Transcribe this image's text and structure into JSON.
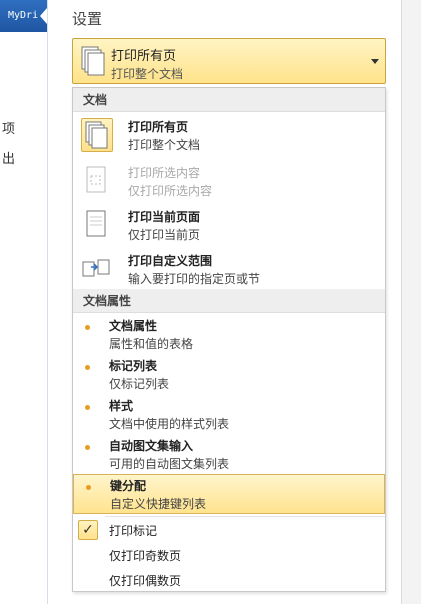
{
  "left_panel": {
    "tab_label": "MyDri",
    "items": [
      "项",
      "出"
    ]
  },
  "settings": {
    "heading": "设置",
    "selector": {
      "title": "打印所有页",
      "subtitle": "打印整个文档",
      "icon": "pages-icon"
    }
  },
  "dropdown": {
    "document_section": {
      "header": "文档",
      "items": [
        {
          "title": "打印所有页",
          "desc": "打印整个文档",
          "icon": "all-pages-icon",
          "highlighted": true,
          "disabled": false
        },
        {
          "title": "打印所选内容",
          "desc": "仅打印所选内容",
          "icon": "selection-icon",
          "highlighted": false,
          "disabled": true
        },
        {
          "title": "打印当前页面",
          "desc": "仅打印当前页",
          "icon": "current-page-icon",
          "highlighted": false,
          "disabled": false
        },
        {
          "title": "打印自定义范围",
          "desc": "输入要打印的指定页或节",
          "icon": "custom-range-icon",
          "highlighted": false,
          "disabled": false
        }
      ]
    },
    "properties_section": {
      "header": "文档属性",
      "items": [
        {
          "title": "文档属性",
          "desc": "属性和值的表格"
        },
        {
          "title": "标记列表",
          "desc": "仅标记列表"
        },
        {
          "title": "样式",
          "desc": "文档中使用的样式列表"
        },
        {
          "title": "自动图文集输入",
          "desc": "可用的自动图文集列表"
        },
        {
          "title": "键分配",
          "desc": "自定义快捷键列表",
          "selected": true
        }
      ]
    },
    "options": [
      {
        "label": "打印标记",
        "checked": true
      },
      {
        "label": "仅打印奇数页",
        "checked": false
      },
      {
        "label": "仅打印偶数页",
        "checked": false
      }
    ]
  },
  "colors": {
    "highlight": "#ffe38b",
    "bullet": "#e99b22",
    "tab": "#2f6fbf"
  }
}
